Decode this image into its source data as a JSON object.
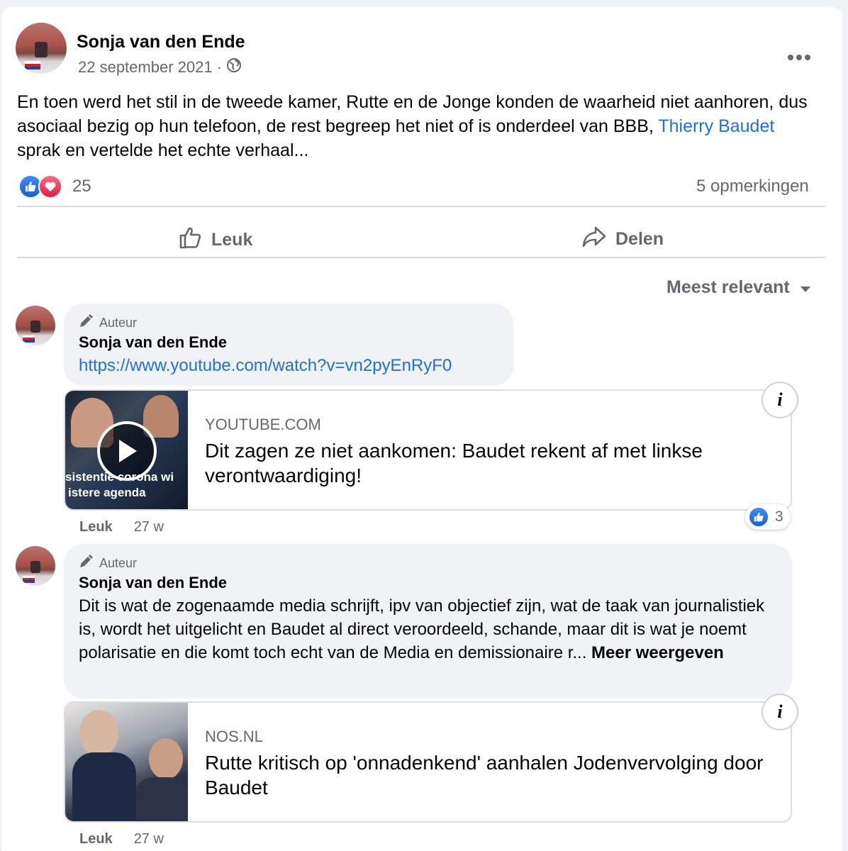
{
  "post": {
    "author": "Sonja van den Ende",
    "date": "22 september 2021",
    "date_separator": "·",
    "text_part1": "En toen werd het stil in de tweede kamer, Rutte en de Jonge konden de waarheid niet aanhoren, dus asociaal bezig op hun telefoon, de rest begreep het niet of is onderdeel van BBB, ",
    "text_link": "Thierry Baudet",
    "text_part2": " sprak en vertelde het echte verhaal...",
    "reaction_count": "25",
    "comments_count": "5 opmerkingen",
    "like_label": "Leuk",
    "share_label": "Delen"
  },
  "sort": {
    "label": "Meest relevant"
  },
  "comments": [
    {
      "badge": "Auteur",
      "author": "Sonja van den Ende",
      "link": "https://www.youtube.com/watch?v=vn2pyEnRyF0",
      "preview": {
        "source": "YOUTUBE.COM",
        "title": "Dit zagen ze niet aankomen: Baudet rekent af met linkse verontwaardiging!",
        "thumb_caption_1": "sistentie corona wi",
        "thumb_caption_2": "istere agenda"
      },
      "like_label": "Leuk",
      "age": "27 w",
      "reaction_count": "3"
    },
    {
      "badge": "Auteur",
      "author": "Sonja van den Ende",
      "text": "Dit is wat de zogenaamde media schrijft, ipv van objectief zijn, wat de taak van journalistiek is, wordt het uitgelicht en Baudet al direct veroordeeld, schande, maar dit is wat je noemt polarisatie en die komt toch echt van de Media en demissionaire r...",
      "more": " Meer weergeven",
      "preview": {
        "source": "NOS.NL",
        "title": "Rutte kritisch op 'onnadenkend' aanhalen Jodenvervolging door Baudet"
      },
      "like_label": "Leuk",
      "age": "27 w"
    }
  ],
  "info_glyph": "i",
  "icons": [
    "globe-icon",
    "more-icon",
    "like-reaction-icon",
    "love-reaction-icon",
    "thumbs-up-icon",
    "share-icon",
    "caret-down-icon",
    "pencil-icon",
    "play-icon",
    "info-icon"
  ]
}
